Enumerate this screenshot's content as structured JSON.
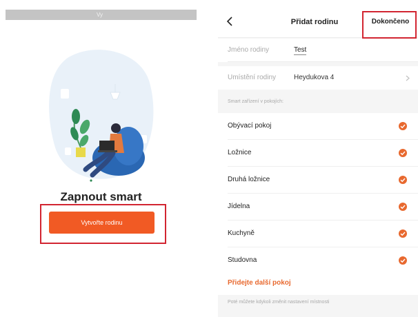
{
  "left_screen": {
    "status_bar": {
      "center_text": "Vy"
    },
    "title": "Zapnout smart",
    "create_button_label": "Vytvořte rodinu"
  },
  "right_screen": {
    "header": {
      "title": "Přidat rodinu",
      "done_label": "Dokončeno"
    },
    "family_name": {
      "label": "Jméno rodiny",
      "value": "Test"
    },
    "family_location": {
      "label": "Umístění rodiny",
      "value": "Heydukova 4"
    },
    "rooms_section_label": "Smart zařízení v pokojích:",
    "rooms": [
      {
        "label": "Obývací pokoj",
        "checked": true
      },
      {
        "label": "Ložnice",
        "checked": true
      },
      {
        "label": "Druhá ložnice",
        "checked": true
      },
      {
        "label": "Jídelna",
        "checked": true
      },
      {
        "label": "Kuchyně",
        "checked": true
      },
      {
        "label": "Studovna",
        "checked": true
      }
    ],
    "add_room_label": "Přidejte další pokoj",
    "footer_hint": "Poté můžete kdykoli změnit nastavení místnosti"
  },
  "colors": {
    "accent": "#f15a24",
    "highlight": "#d22430",
    "check": "#e8692f"
  }
}
